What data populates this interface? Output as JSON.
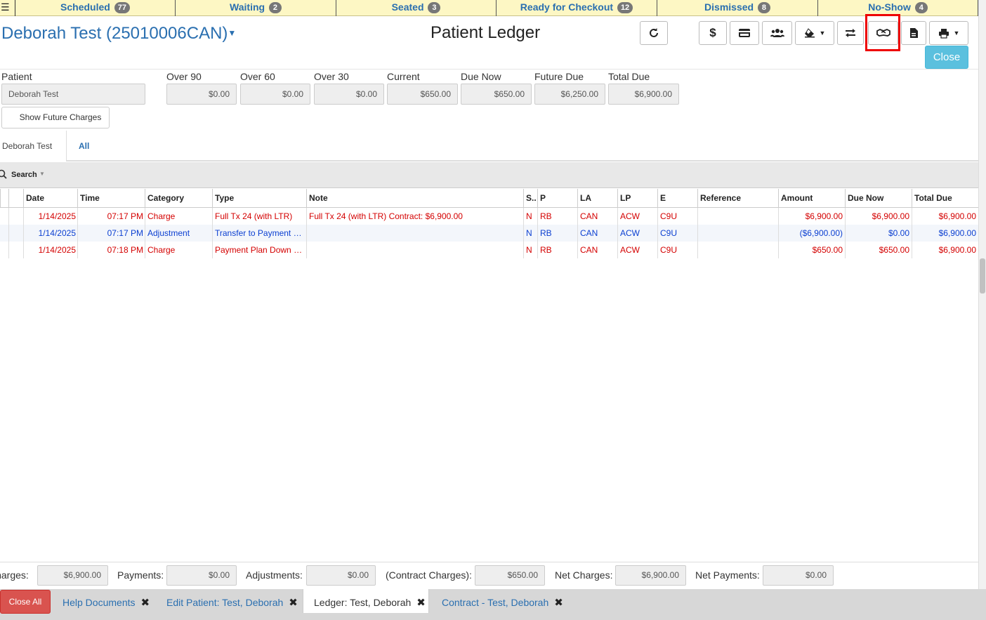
{
  "status_tabs": [
    {
      "label": "Scheduled",
      "count": "77"
    },
    {
      "label": "Waiting",
      "count": "2"
    },
    {
      "label": "Seated",
      "count": "3"
    },
    {
      "label": "Ready for Checkout",
      "count": "12"
    },
    {
      "label": "Dismissed",
      "count": "8"
    },
    {
      "label": "No-Show",
      "count": "4"
    }
  ],
  "header": {
    "patient_title": "Deborah Test (25010006CAN)",
    "page_title": "Patient Ledger",
    "close_label": "Close"
  },
  "toolbar_icons": [
    "refresh-icon",
    "dollar-icon",
    "credit-card-icon",
    "users-icon",
    "eraser-icon",
    "transfer-icon",
    "handshake-icon",
    "document-icon",
    "print-icon"
  ],
  "summary": {
    "patient_label": "Patient",
    "patient_value": "Deborah Test",
    "fields": [
      {
        "label": "Over 90",
        "value": "$0.00"
      },
      {
        "label": "Over 60",
        "value": "$0.00"
      },
      {
        "label": "Over 30",
        "value": "$0.00"
      },
      {
        "label": "Current",
        "value": "$650.00"
      },
      {
        "label": "Due Now",
        "value": "$650.00"
      },
      {
        "label": "Future Due",
        "value": "$6,250.00"
      },
      {
        "label": "Total Due",
        "value": "$6,900.00"
      }
    ],
    "future_charges_label": "Show Future Charges"
  },
  "person_tabs": [
    "Deborah Test",
    "All"
  ],
  "search_label": "Search",
  "table": {
    "columns": [
      "Date",
      "Time",
      "Category",
      "Type",
      "Note",
      "S..",
      "P",
      "LA",
      "LP",
      "E",
      "Reference",
      "Amount",
      "Due Now",
      "Total Due"
    ],
    "rows": [
      {
        "color": "red",
        "cells": [
          "1/14/2025",
          "07:17 PM",
          "Charge",
          "Full Tx 24 (with LTR)",
          "Full Tx 24 (with LTR) Contract: $6,900.00",
          "N",
          "RB",
          "CAN",
          "ACW",
          "C9U",
          "",
          "$6,900.00",
          "$6,900.00",
          "$6,900.00"
        ]
      },
      {
        "color": "blue",
        "cells": [
          "1/14/2025",
          "07:17 PM",
          "Adjustment",
          "Transfer to Payment Plan",
          "",
          "N",
          "RB",
          "CAN",
          "ACW",
          "C9U",
          "",
          "($6,900.00)",
          "$0.00",
          "$6,900.00"
        ]
      },
      {
        "color": "red",
        "cells": [
          "1/14/2025",
          "07:18 PM",
          "Charge",
          "Payment Plan Down Payment",
          "",
          "N",
          "RB",
          "CAN",
          "ACW",
          "C9U",
          "",
          "$650.00",
          "$650.00",
          "$6,900.00"
        ]
      }
    ]
  },
  "totals": [
    {
      "label": "Charges:",
      "value": "$6,900.00"
    },
    {
      "label": "Payments:",
      "value": "$0.00"
    },
    {
      "label": "Adjustments:",
      "value": "$0.00"
    },
    {
      "label": "(Contract Charges):",
      "value": "$650.00"
    },
    {
      "label": "Net Charges:",
      "value": "$6,900.00"
    },
    {
      "label": "Net Payments:",
      "value": "$0.00"
    }
  ],
  "bottom_tabs": {
    "close_all_label": "Close All",
    "tabs": [
      "Help Documents",
      "Edit Patient: Test, Deborah",
      "Ledger: Test, Deborah",
      "Contract - Test, Deborah"
    ]
  }
}
